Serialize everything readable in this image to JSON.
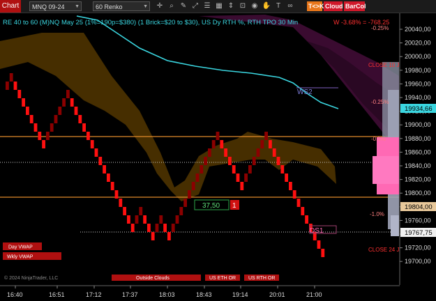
{
  "toolbar": {
    "chart_tab": "Chart",
    "instrument": "MNQ 09-24",
    "bar_type": "60 Renko",
    "tk_label": "T<>K",
    "cloud_label": "Cloud",
    "barcol_label": "BarCol"
  },
  "header": {
    "indicator_text": "RE 40 to 60 (M)NQ May 25 (1%=190p=$380) (1 Brick=$20 to $30), US Dy RTH %, RTH TPO 30 Min",
    "weekly_text": "W -3.68% = -768.25"
  },
  "price_axis": {
    "ticks": [
      "20040,00",
      "20020,00",
      "20000,00",
      "19980,00",
      "19960,00",
      "19940,00",
      "19920,00",
      "19900,00",
      "19880,00",
      "19860,00",
      "19840,00",
      "19820,00",
      "19800,00",
      "19780,00",
      "19760,00",
      "19740,00",
      "19720,00",
      "19700,00"
    ],
    "tag_cyan": "19934,66",
    "tag_tan": "19804,00",
    "tag_white": "19767,75"
  },
  "time_axis": {
    "labels": [
      "16:40",
      "16:51",
      "17:12",
      "17:37",
      "18:03",
      "18:43",
      "19:14",
      "20:01",
      "21:00"
    ]
  },
  "annotations": {
    "pct_top": "-0.25%",
    "pct_mid": "-0.25%",
    "pct_05": "-0.5%",
    "pct_10": "-1.0%",
    "close_top": "CLOSE 10 J",
    "close_bottom": "CLOSE 24 J",
    "ws2": "WS2",
    "ds1": "DS1",
    "box_value": "37,50",
    "box_count": "1"
  },
  "buttons": {
    "day_vwap": "Day VWAP",
    "wkly_vwap": "Wkly VWAP",
    "outside_clouds": "Outside Clouds",
    "us_eth_or": "US ETH OR",
    "us_rth_or": "US RTH OR",
    "copyright": "© 2024 NinjaTrader, LLC"
  },
  "colors": {
    "up_brick": "#8b0000",
    "down_brick": "#ff1010",
    "cloud_brown": "#4a3000",
    "cloud_purple": "#3a0b30",
    "cyan_line": "#3ad6e0",
    "orange_line": "#e08a2a",
    "pink_profile": "#ff69b4"
  }
}
